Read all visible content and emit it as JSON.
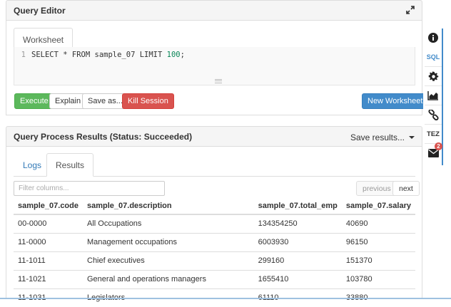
{
  "query_editor": {
    "title": "Query Editor",
    "tab_label": "Worksheet",
    "line_number": "1",
    "code_prefix": "SELECT * FROM sample_07 LIMIT ",
    "code_number": "100",
    "code_suffix": ";",
    "buttons": {
      "execute": "Execute",
      "explain": "Explain",
      "save_as": "Save as...",
      "kill_session": "Kill Session",
      "new_worksheet": "New Worksheet"
    }
  },
  "results_panel": {
    "title": "Query Process Results (Status: Succeeded)",
    "save_results": "Save results...",
    "tabs": [
      "Logs",
      "Results"
    ],
    "filter_placeholder": "Filter columns...",
    "previous": "previous",
    "next": "next",
    "columns": [
      "sample_07.code",
      "sample_07.description",
      "sample_07.total_emp",
      "sample_07.salary"
    ],
    "rows": [
      [
        "00-0000",
        "All Occupations",
        "134354250",
        "40690"
      ],
      [
        "11-0000",
        "Management occupations",
        "6003930",
        "96150"
      ],
      [
        "11-1011",
        "Chief executives",
        "299160",
        "151370"
      ],
      [
        "11-1021",
        "General and operations managers",
        "1655410",
        "103780"
      ],
      [
        "11-1031",
        "Legislators",
        "61110",
        "33880"
      ]
    ]
  },
  "side_bar": {
    "sql_label": "SQL",
    "tez_label": "TEZ",
    "mail_badge": "2"
  },
  "colors": {
    "execute": "#5cb85c",
    "kill": "#d9534f",
    "primary": "#428bca",
    "link": "#337ab7"
  }
}
